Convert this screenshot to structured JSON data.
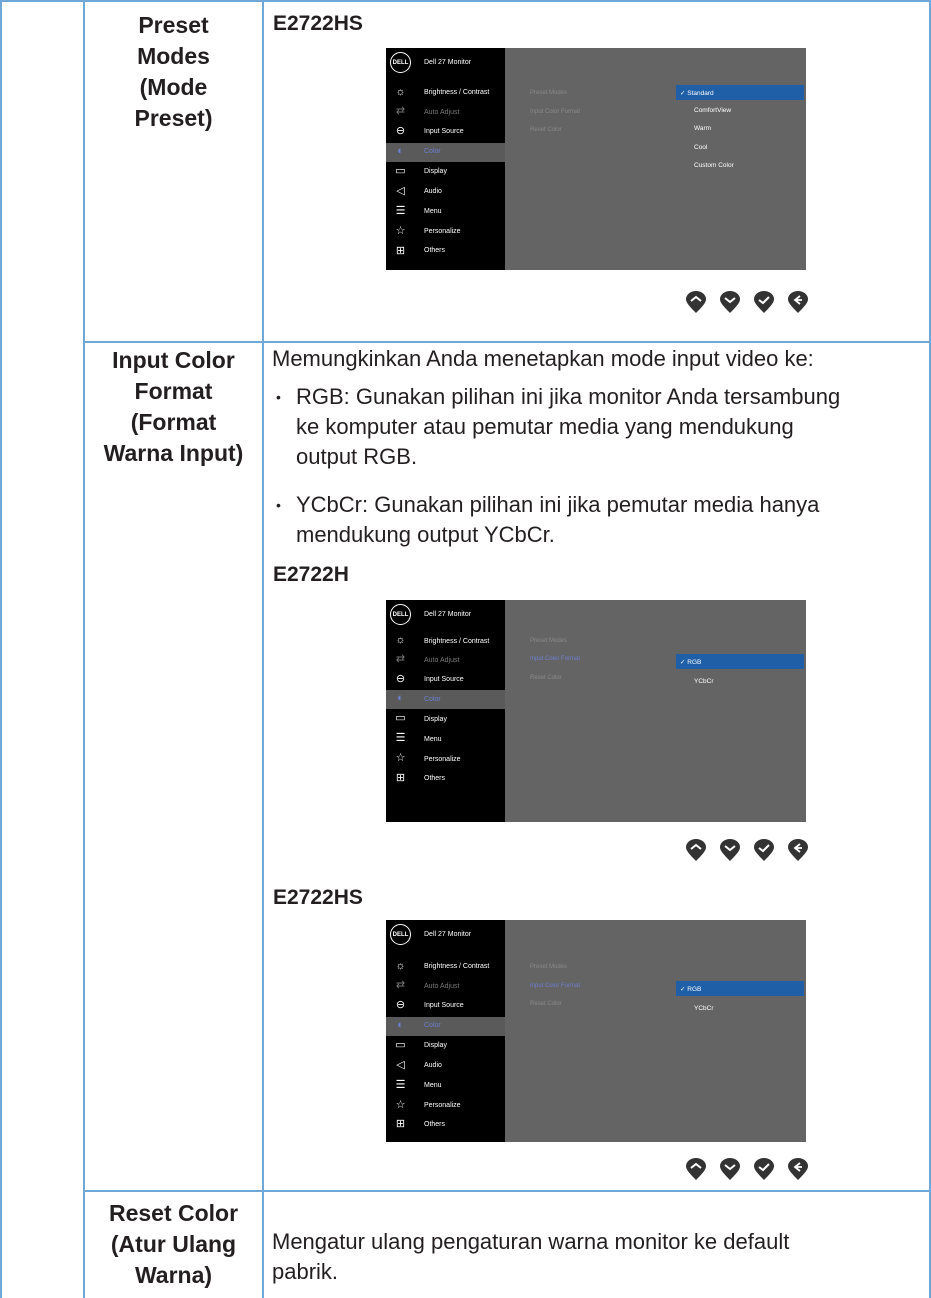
{
  "rows": [
    {
      "label": [
        "Preset",
        "Modes",
        "(Mode",
        "Preset)"
      ]
    },
    {
      "label": [
        "Input Color",
        "Format",
        "(Format",
        "Warna Input)"
      ]
    },
    {
      "label": [
        "Reset Color",
        "(Atur Ulang",
        "Warna)"
      ]
    }
  ],
  "preset_model": "E2722HS",
  "input_intro": "Memungkinkan Anda menetapkan mode input video ke:",
  "bullets": [
    {
      "term": "RGB:",
      "text": " Gunakan pilihan ini jika monitor Anda tersambung",
      "l2": "ke komputer atau pemutar media yang mendukung",
      "l3": "output RGB."
    },
    {
      "term": "YCbCr:",
      "text": " Gunakan pilihan ini jika pemutar media hanya",
      "l2": "mendukung output YCbCr.",
      "l3": ""
    }
  ],
  "model_h": "E2722H",
  "model_hs": "E2722HS",
  "reset_text_1": "Mengatur ulang pengaturan warna monitor ke default",
  "reset_text_2": "pabrik.",
  "osd": {
    "logo": "DELL",
    "title": "Dell 27 Monitor",
    "menu_hs": [
      "Brightness / Contrast",
      "Auto Adjust",
      "Input Source",
      "Color",
      "Display",
      "Audio",
      "Menu",
      "Personalize",
      "Others"
    ],
    "menu_h": [
      "Brightness / Contrast",
      "Auto Adjust",
      "Input Source",
      "Color",
      "Display",
      "Menu",
      "Personalize",
      "Others"
    ],
    "submenu": [
      "Preset Modes",
      "Input Color Format",
      "Reset Color"
    ],
    "preset_options": [
      "Standard",
      "ComfortView",
      "Warm",
      "Cool",
      "Custom Color"
    ],
    "format_options": [
      "RGB",
      "YCbCr"
    ]
  },
  "colors": {
    "border": "#6fa8d6",
    "osd_highlight": "#1f5fa8",
    "osd_panel": "#646464"
  }
}
